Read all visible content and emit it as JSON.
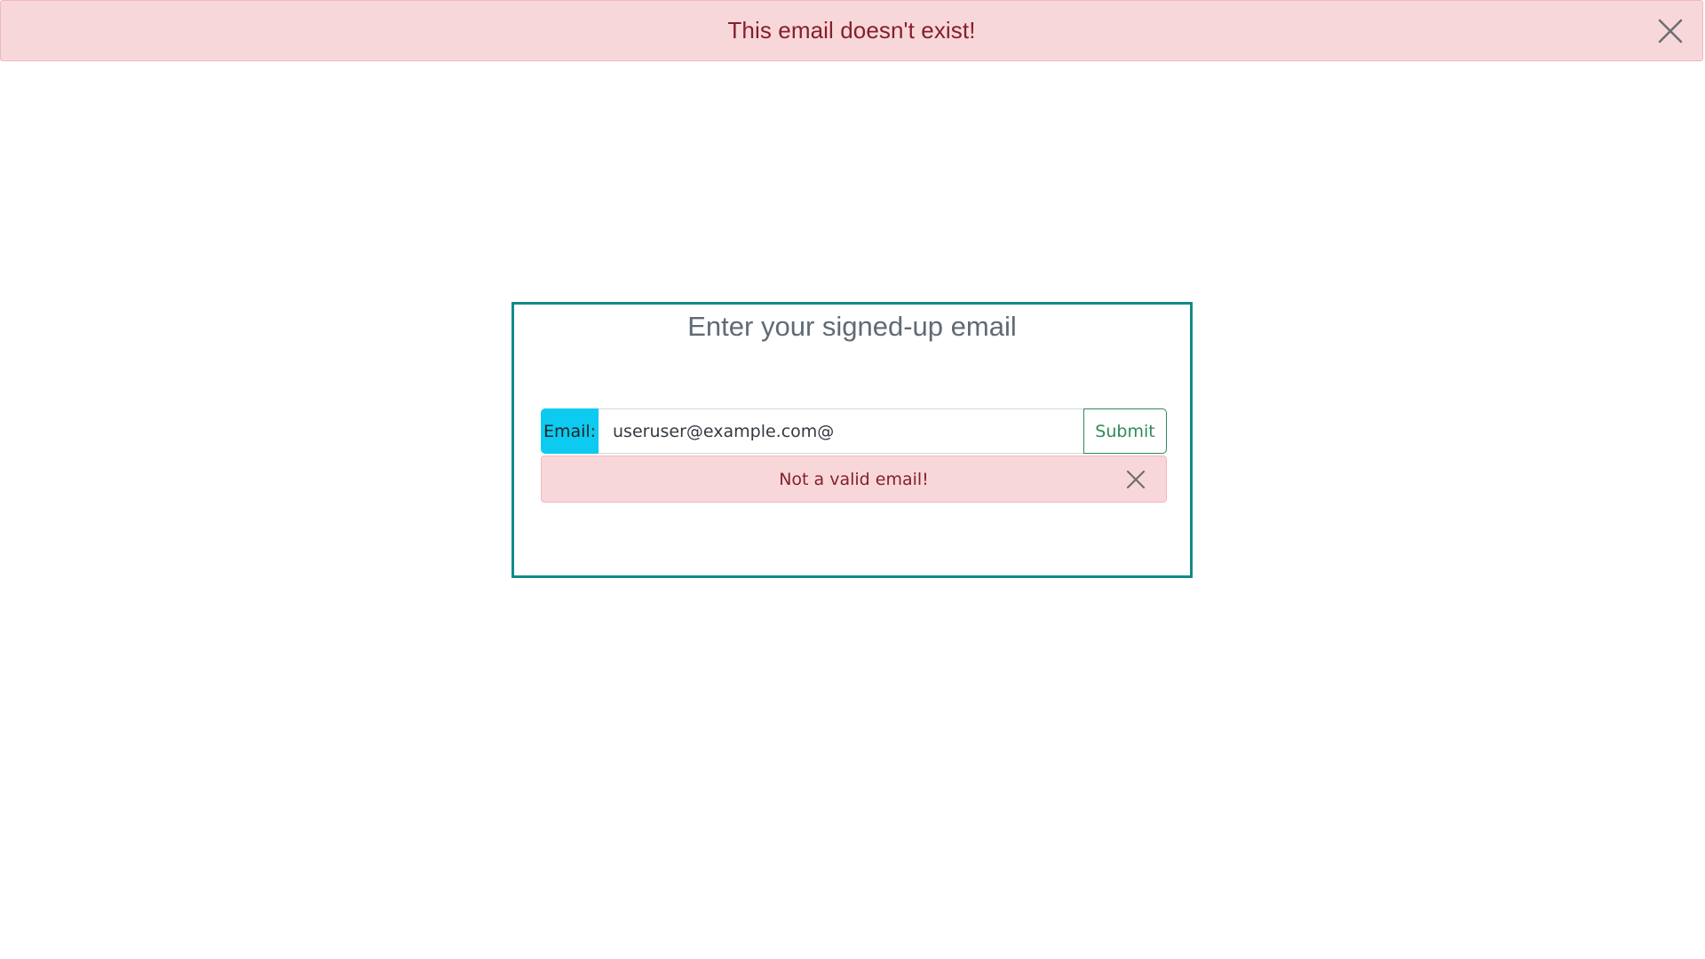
{
  "top_alert": {
    "message": "This email doesn't exist!",
    "close_icon": "close-icon"
  },
  "form": {
    "title": "Enter your signed-up email",
    "email_label": "Email:",
    "email_value": "useruser@example.com@",
    "submit_label": "Submit",
    "validation_alert": {
      "message": "Not a valid email!",
      "close_icon": "close-icon"
    }
  },
  "colors": {
    "alert_bg": "#f8d7da",
    "alert_text": "#842029",
    "card_border": "#138a8a",
    "label_bg": "#0dcaf0",
    "submit_accent": "#2f8a57"
  }
}
